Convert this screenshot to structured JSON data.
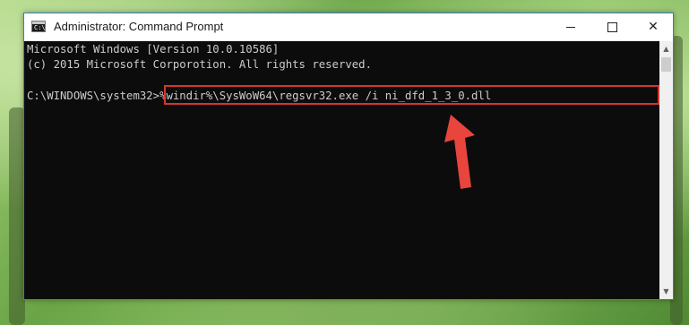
{
  "window": {
    "title": "Administrator: Command Prompt",
    "icon_text": "C:\\",
    "controls": {
      "minimize": "minimize",
      "maximize": "maximize",
      "close": "close"
    }
  },
  "console": {
    "lines": [
      "Microsoft Windows [Version 10.0.10586]",
      "(c) 2015 Microsoft Corporotion. All rights reserved.",
      "C:\\WINDOWS\\system32>%windir%\\SysWoW64\\regsvr32.exe /i ni_dfd_1_3_0.dll"
    ],
    "text_color": "#cccccc",
    "background_color": "#0c0c0c"
  },
  "annotation": {
    "highlight_color": "#d9342b",
    "arrow_color": "#e8453c"
  },
  "icons": {
    "app": "cmd-icon",
    "scroll_up": "scroll-up-arrow-icon",
    "scroll_down": "scroll-down-arrow-icon",
    "pointer": "red-arrow-icon"
  }
}
